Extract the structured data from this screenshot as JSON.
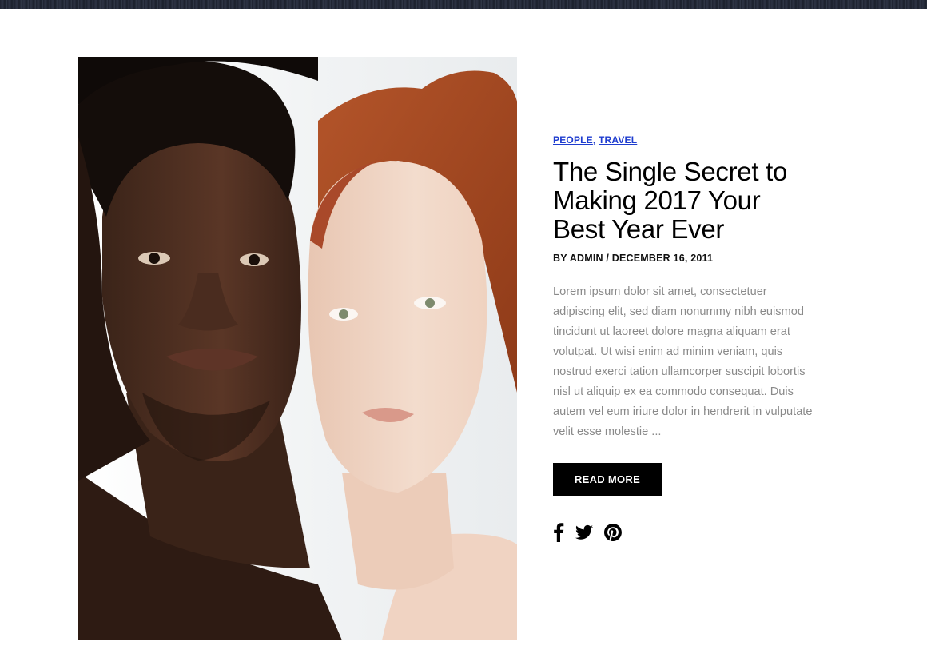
{
  "post": {
    "image": {
      "alt": "Portrait photo of a man and a woman"
    },
    "categories": [
      {
        "label": "PEOPLE"
      },
      {
        "label": "TRAVEL"
      }
    ],
    "category_separator": ",",
    "title": "The Single Secret to Making 2017 Your Best Year Ever",
    "meta": "BY ADMIN / DECEMBER 16, 2011",
    "excerpt": "Lorem ipsum dolor sit amet, consectetuer adipiscing elit, sed diam nonummy nibh euismod tincidunt ut laoreet dolore magna aliquam erat volutpat. Ut wisi enim ad minim veniam, quis nostrud exerci tation ullamcorper suscipit lobortis nisl ut aliquip ex ea commodo consequat. Duis autem vel eum iriure dolor in hendrerit in vulputate velit esse molestie ...",
    "read_more_label": "READ MORE",
    "share_icons": [
      "facebook-icon",
      "twitter-icon",
      "pinterest-icon"
    ]
  },
  "colors": {
    "category_link": "#1e3ccf",
    "button_bg": "#000000",
    "button_text": "#ffffff",
    "excerpt_text": "#8a8a8a"
  }
}
